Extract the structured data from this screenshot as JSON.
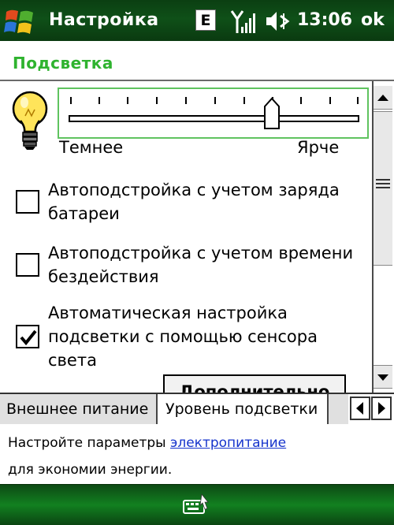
{
  "window": {
    "title": "Настройка",
    "network_badge": "E",
    "clock": "13:06",
    "ok_label": "ok",
    "icons": {
      "start": "windows-start-icon",
      "signal": "signal-strength-icon",
      "volume": "speaker-muted-icon",
      "keyboard": "keyboard-input-icon",
      "bulb": "light-bulb-icon"
    }
  },
  "page": {
    "heading": "Подсветка"
  },
  "brightness": {
    "label_dark": "Темнее",
    "label_bright": "Ярче",
    "level_fraction": 0.7
  },
  "options": [
    {
      "label": "Автоподстройка с учетом заряда батареи",
      "checked": false
    },
    {
      "label": "Автоподстройка с учетом времени бездействия",
      "checked": false
    },
    {
      "label": "Автоматическая настройка подсветки с помощью сенсора света",
      "checked": true
    }
  ],
  "advanced_button": "Дополнительно",
  "tabs": [
    {
      "label": "Внешнее питание",
      "active": false
    },
    {
      "label": "Уровень подсветки",
      "active": true
    }
  ],
  "hint": {
    "before_link": "Настройте параметры ",
    "link": "электропитание",
    "after_link": "для экономии энергии."
  },
  "colors": {
    "accent_green": "#2fb32f",
    "titlebar_green": "#0f5018",
    "link_blue": "#1533cc"
  }
}
